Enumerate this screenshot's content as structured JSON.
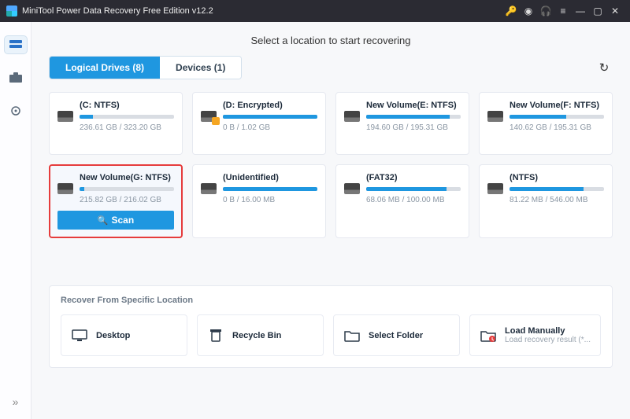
{
  "titlebar": {
    "app_title": "MiniTool Power Data Recovery Free Edition v12.2"
  },
  "main": {
    "heading": "Select a location to start recovering",
    "tabs": [
      {
        "label": "Logical Drives (8)",
        "active": true
      },
      {
        "label": "Devices (1)",
        "active": false
      }
    ],
    "drives": [
      {
        "name": "(C: NTFS)",
        "size": "236.61 GB / 323.20 GB",
        "fill": 14,
        "locked": false,
        "selected": false
      },
      {
        "name": "(D: Encrypted)",
        "size": "0 B / 1.02 GB",
        "fill": 100,
        "locked": true,
        "selected": false
      },
      {
        "name": "New Volume(E: NTFS)",
        "size": "194.60 GB / 195.31 GB",
        "fill": 88,
        "locked": false,
        "selected": false
      },
      {
        "name": "New Volume(F: NTFS)",
        "size": "140.62 GB / 195.31 GB",
        "fill": 60,
        "locked": false,
        "selected": false
      },
      {
        "name": "New Volume(G: NTFS)",
        "size": "215.82 GB / 216.02 GB",
        "fill": 5,
        "locked": false,
        "selected": true
      },
      {
        "name": "(Unidentified)",
        "size": "0 B / 16.00 MB",
        "fill": 100,
        "locked": false,
        "selected": false
      },
      {
        "name": "(FAT32)",
        "size": "68.06 MB / 100.00 MB",
        "fill": 85,
        "locked": false,
        "selected": false
      },
      {
        "name": "(NTFS)",
        "size": "81.22 MB / 546.00 MB",
        "fill": 78,
        "locked": false,
        "selected": false
      }
    ],
    "scan_label": "Scan",
    "location_section_title": "Recover From Specific Location",
    "locations": [
      {
        "icon": "desktop",
        "label": "Desktop",
        "sub": ""
      },
      {
        "icon": "trash",
        "label": "Recycle Bin",
        "sub": ""
      },
      {
        "icon": "folder",
        "label": "Select Folder",
        "sub": ""
      },
      {
        "icon": "load",
        "label": "Load Manually",
        "sub": "Load recovery result (*..."
      }
    ]
  }
}
